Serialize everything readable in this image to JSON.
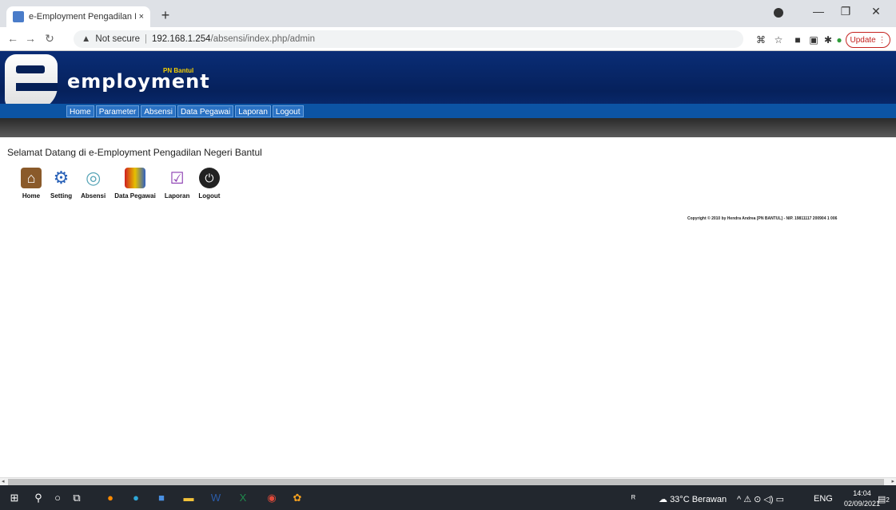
{
  "browser": {
    "tab_title": "e-Employment Pengadilan Negeri",
    "tab_close": "×",
    "new_tab": "+",
    "url_warning": "Not secure",
    "url_host": "192.168.1.254",
    "url_path": "/absensi/index.php/admin",
    "update_label": "Update"
  },
  "site": {
    "logo_text": "employment",
    "logo_sub": "PN Bantul",
    "menu": [
      "Home",
      "Parameter",
      "Absensi",
      "Data Pegawai",
      "Laporan",
      "Logout"
    ],
    "welcome": "Selamat Datang di e-Employment Pengadilan Negeri Bantul",
    "shortcuts": [
      {
        "label": "Home",
        "icon": "home-icon"
      },
      {
        "label": "Setting",
        "icon": "gear-icon"
      },
      {
        "label": "Absensi",
        "icon": "fingerprint-icon"
      },
      {
        "label": "Data Pegawai",
        "icon": "people-icon"
      },
      {
        "label": "Laporan",
        "icon": "report-icon"
      },
      {
        "label": "Logout",
        "icon": "power-icon"
      }
    ],
    "copyright": "Copyright © 2010 by Hendra Andrea [PN BANTUL] - NIP. 19811117 200904 1 006"
  },
  "taskbar": {
    "weather": "33°C Berawan",
    "lang": "ENG",
    "time": "14:04",
    "date": "02/09/2021",
    "notif_count": "2"
  }
}
